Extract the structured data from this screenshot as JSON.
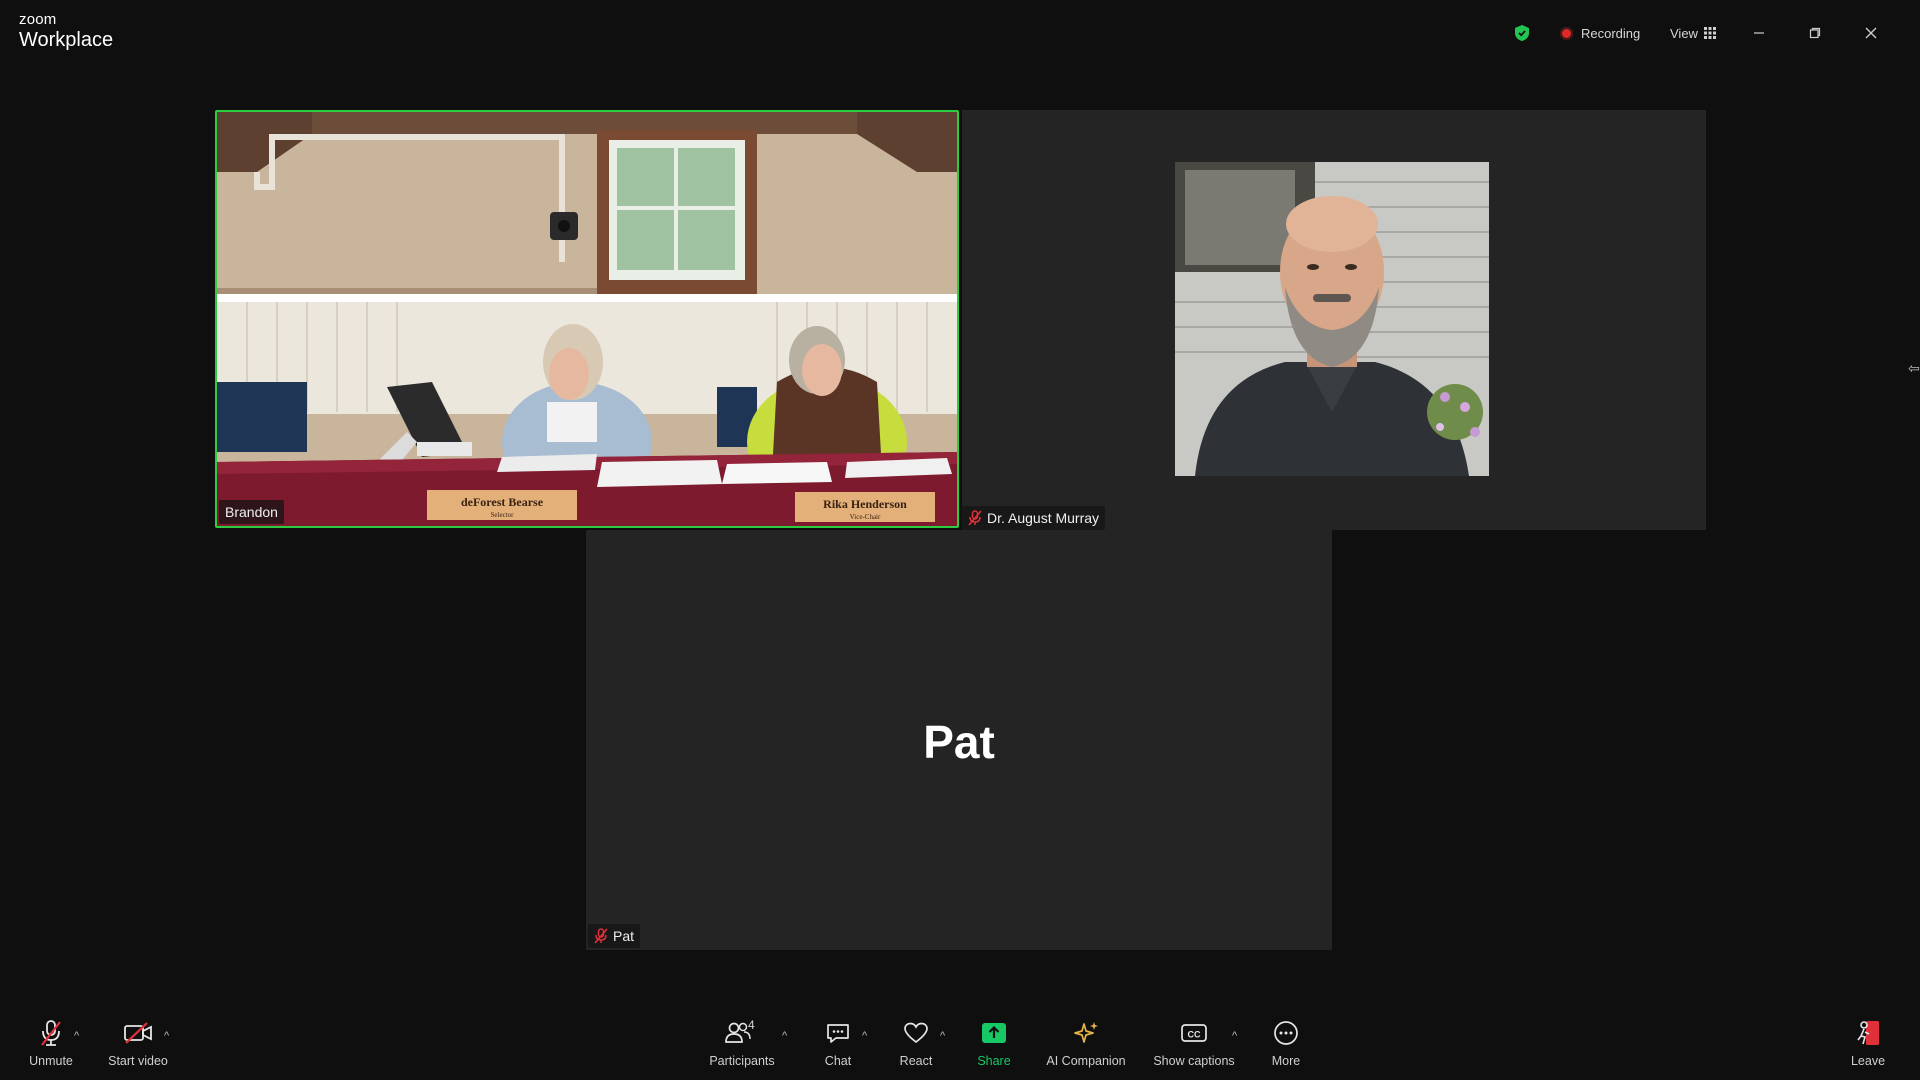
{
  "app": {
    "brand_small": "zoom",
    "brand_large": "Workplace",
    "recording_label": "Recording",
    "view_label": "View"
  },
  "tiles": {
    "brandon": {
      "name": "Brandon",
      "placard_left": "deForest Bearse",
      "placard_left_sub": "Selector",
      "placard_right": "Rika Henderson",
      "placard_right_sub": "Vice-Chair"
    },
    "august": {
      "name": "Dr. August Murray"
    },
    "pat": {
      "name": "Pat",
      "display_name": "Pat"
    }
  },
  "toolbar": {
    "unmute": "Unmute",
    "start_video": "Start video",
    "participants": "Participants",
    "participants_count": "4",
    "chat": "Chat",
    "react": "React",
    "share": "Share",
    "ai_companion": "AI Companion",
    "show_captions": "Show captions",
    "more": "More",
    "leave": "Leave"
  },
  "colors": {
    "active_speaker_border": "#2ecc40",
    "share_green": "#17c964",
    "muted_red": "#e0303a",
    "recording_red": "#e02828",
    "ai_gold": "#e8b34b"
  }
}
